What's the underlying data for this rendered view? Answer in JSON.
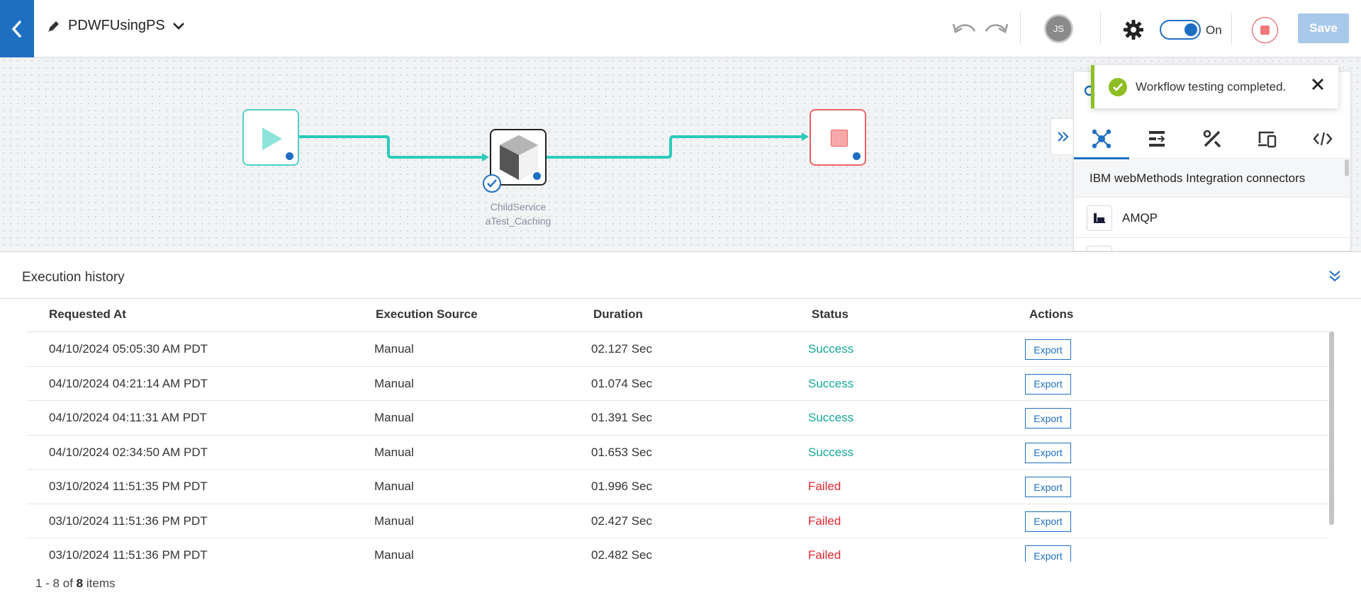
{
  "header": {
    "workflow_name": "PDWFUsingPS",
    "avatar_initials": "JS",
    "toggle_label": "On",
    "save_label": "Save"
  },
  "canvas": {
    "service_node_label_line1": "ChildService",
    "service_node_label_line2": "aTest_Caching"
  },
  "toast": {
    "message": "Workflow testing completed."
  },
  "right_panel": {
    "section_title": "IBM webMethods Integration connectors",
    "connectors": [
      {
        "name": "AMQP"
      }
    ],
    "tabs": [
      "connectors-icon",
      "flow-icon",
      "tools-icon",
      "devices-icon",
      "code-icon"
    ]
  },
  "history": {
    "title": "Execution history",
    "columns": {
      "requested_at": "Requested At",
      "execution_source": "Execution Source",
      "duration": "Duration",
      "status": "Status",
      "actions": "Actions"
    },
    "rows": [
      {
        "requested_at": "04/10/2024 05:05:30 AM PDT",
        "source": "Manual",
        "duration": "02.127 Sec",
        "status": "Success",
        "action": "Export"
      },
      {
        "requested_at": "04/10/2024 04:21:14 AM PDT",
        "source": "Manual",
        "duration": "01.074 Sec",
        "status": "Success",
        "action": "Export"
      },
      {
        "requested_at": "04/10/2024 04:11:31 AM PDT",
        "source": "Manual",
        "duration": "01.391 Sec",
        "status": "Success",
        "action": "Export"
      },
      {
        "requested_at": "04/10/2024 02:34:50 AM PDT",
        "source": "Manual",
        "duration": "01.653 Sec",
        "status": "Success",
        "action": "Export"
      },
      {
        "requested_at": "03/10/2024 11:51:35 PM PDT",
        "source": "Manual",
        "duration": "01.996 Sec",
        "status": "Failed",
        "action": "Export"
      },
      {
        "requested_at": "03/10/2024 11:51:36 PM PDT",
        "source": "Manual",
        "duration": "02.427 Sec",
        "status": "Failed",
        "action": "Export"
      },
      {
        "requested_at": "03/10/2024 11:51:36 PM PDT",
        "source": "Manual",
        "duration": "02.482 Sec",
        "status": "Failed",
        "action": "Export"
      }
    ],
    "pager": {
      "range": "1 - 8 of",
      "total": "8",
      "suffix": "items"
    }
  },
  "colors": {
    "accent": "#1e6fc2",
    "success": "#14a79a",
    "failed": "#e0262f",
    "toast_accent": "#8fbe24"
  }
}
